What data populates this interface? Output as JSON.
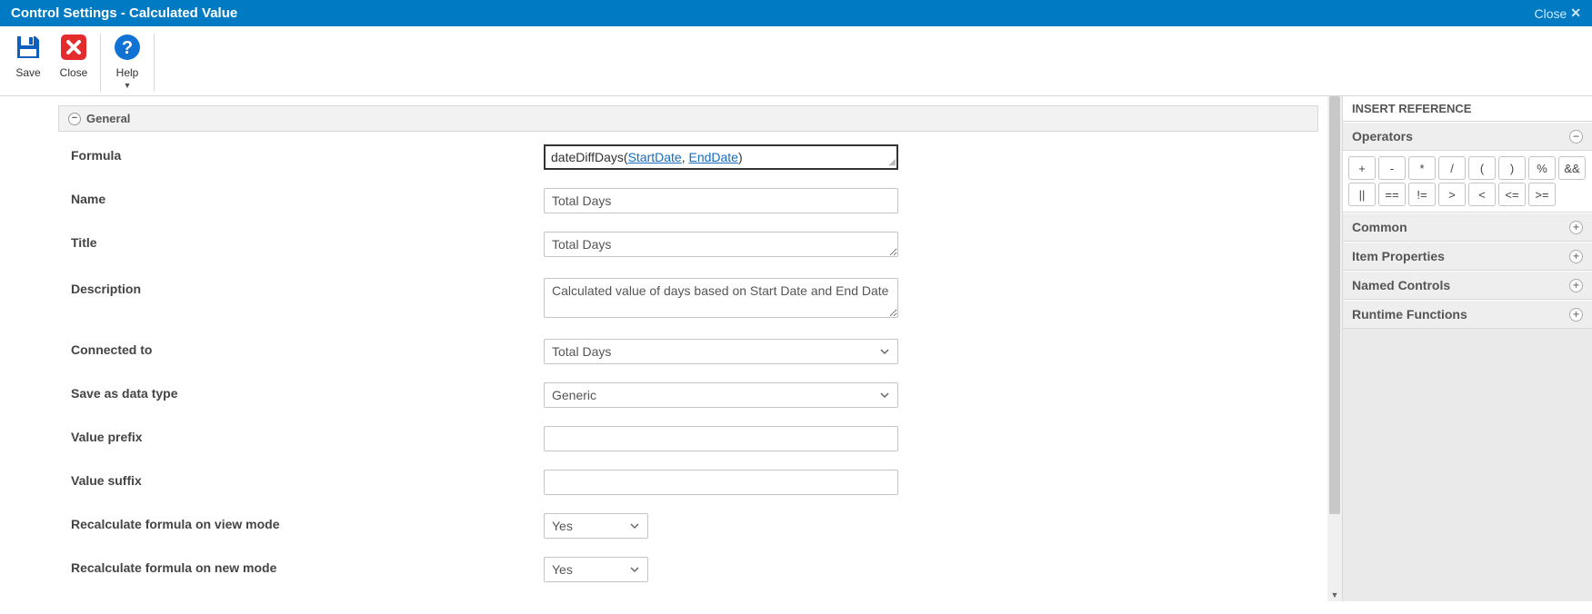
{
  "titlebar": {
    "title": "Control Settings - Calculated Value",
    "close_label": "Close"
  },
  "toolbar": {
    "save_label": "Save",
    "close_label": "Close",
    "help_label": "Help"
  },
  "section": {
    "general_label": "General"
  },
  "labels": {
    "formula": "Formula",
    "name": "Name",
    "title": "Title",
    "description": "Description",
    "connected_to": "Connected to",
    "save_as_data_type": "Save as data type",
    "value_prefix": "Value prefix",
    "value_suffix": "Value suffix",
    "recalc_view": "Recalculate formula on view mode",
    "recalc_new": "Recalculate formula on new mode"
  },
  "values": {
    "formula_prefix": "dateDiffDays(",
    "formula_ref1": "StartDate",
    "formula_sep": ", ",
    "formula_ref2": "EndDate",
    "formula_suffix": ")",
    "name": "Total Days",
    "title": "Total Days",
    "description": "Calculated value of days based on Start Date and End Date",
    "connected_to": "Total Days",
    "save_as_data_type": "Generic",
    "value_prefix": "",
    "value_suffix": "",
    "recalc_view": "Yes",
    "recalc_new": "Yes"
  },
  "right": {
    "header": "INSERT REFERENCE",
    "sections": {
      "operators": "Operators",
      "common": "Common",
      "item_properties": "Item Properties",
      "named_controls": "Named Controls",
      "runtime_functions": "Runtime Functions"
    },
    "operators": [
      "+",
      "-",
      "*",
      "/",
      "(",
      ")",
      "%",
      "&&",
      "||",
      "==",
      "!=",
      ">",
      "<",
      "<=",
      ">="
    ]
  }
}
